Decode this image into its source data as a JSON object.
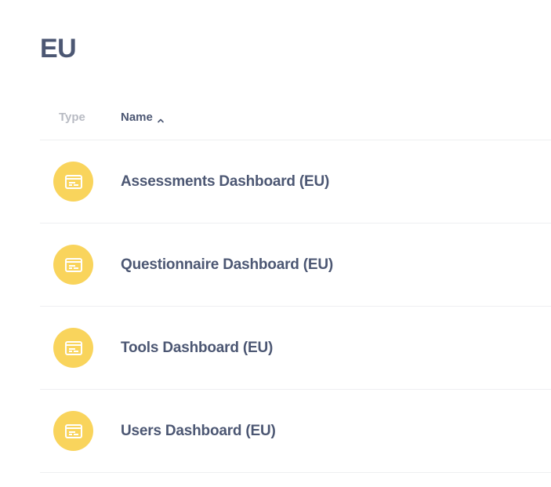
{
  "collection": {
    "title": "EU"
  },
  "table": {
    "columns": {
      "type": "Type",
      "name": "Name",
      "sort_icon": "chevron-up-icon"
    },
    "rows": [
      {
        "name": "Assessments Dashboard (EU)",
        "icon": "dashboard-icon"
      },
      {
        "name": "Questionnaire Dashboard (EU)",
        "icon": "dashboard-icon"
      },
      {
        "name": "Tools Dashboard (EU)",
        "icon": "dashboard-icon"
      },
      {
        "name": "Users Dashboard (EU)",
        "icon": "dashboard-icon"
      }
    ]
  },
  "colors": {
    "text": "#4c5773",
    "muted": "#b8bbc3",
    "dashboard_icon_bg": "#f9d45c",
    "divider": "#eeeff1"
  }
}
